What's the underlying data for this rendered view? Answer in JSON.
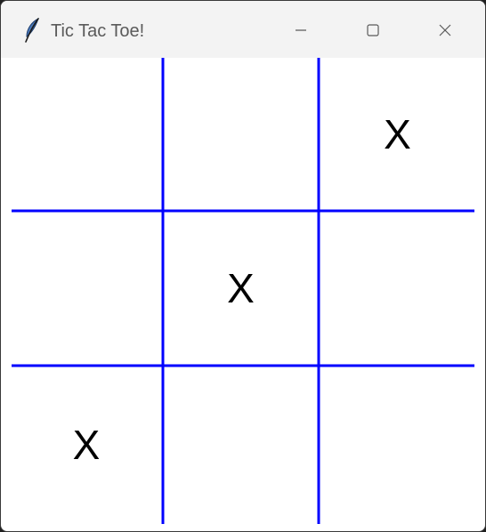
{
  "window": {
    "title": "Tic Tac Toe!",
    "app_icon": "feather-icon",
    "controls": {
      "minimize_icon": "minimize-icon",
      "maximize_icon": "maximize-icon",
      "close_icon": "close-icon"
    }
  },
  "board": {
    "grid_color": "#0000ff",
    "mark_color": "#000000",
    "cells": [
      [
        "",
        "",
        "X"
      ],
      [
        "",
        "X",
        ""
      ],
      [
        "X",
        "",
        ""
      ]
    ]
  }
}
